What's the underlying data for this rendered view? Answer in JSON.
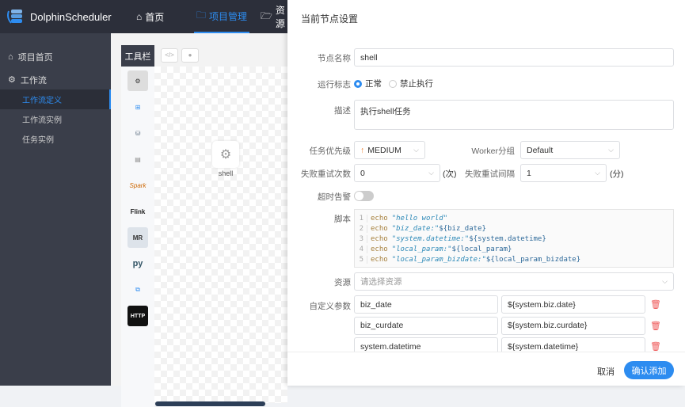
{
  "header": {
    "app_name": "DolphinScheduler",
    "nav": [
      {
        "label": "首页",
        "icon": "home-icon"
      },
      {
        "label": "项目管理",
        "icon": "folder-settings-icon",
        "active": true
      },
      {
        "label": "资源",
        "icon": "folder-icon"
      }
    ]
  },
  "sidebar": {
    "items": [
      {
        "label": "项目首页",
        "icon": "home-icon"
      },
      {
        "label": "工作流",
        "icon": "gear-icon"
      }
    ],
    "sub_items": [
      {
        "label": "工作流定义",
        "active": true
      },
      {
        "label": "工作流实例"
      },
      {
        "label": "任务实例"
      }
    ]
  },
  "canvas": {
    "toolbar_label": "工具栏",
    "tool_buttons": [
      "</>",
      "●"
    ],
    "tools": [
      "shell",
      "sub_process",
      "procedure",
      "sql",
      "spark",
      "flink",
      "mr",
      "python",
      "dependent",
      "http"
    ],
    "tool_text": {
      "spark": "Spark",
      "flink": "Flink",
      "mr": "MR",
      "python": "py",
      "http": "HTTP"
    },
    "node_label": "shell"
  },
  "drawer": {
    "title": "当前节点设置",
    "node_name_label": "节点名称",
    "node_name": "shell",
    "run_flag_label": "运行标志",
    "run_flag_options": [
      "正常",
      "禁止执行"
    ],
    "run_flag_selected": "正常",
    "desc_label": "描述",
    "desc": "执行shell任务",
    "priority_label": "任务优先级",
    "priority": "MEDIUM",
    "priority_color": "#f0802d",
    "worker_group_label": "Worker分组",
    "worker_group": "Default",
    "retry_times_label": "失败重试次数",
    "retry_times": "0",
    "retry_times_unit": "(次)",
    "retry_interval_label": "失败重试间隔",
    "retry_interval": "1",
    "retry_interval_unit": "(分)",
    "timeout_label": "超时告警",
    "timeout_enabled": false,
    "script_label": "脚本",
    "script_lines": [
      {
        "n": "1",
        "kw": "echo",
        "str": "\"hello world\"",
        "var": ""
      },
      {
        "n": "2",
        "kw": "echo",
        "str": "\"biz_date:\"",
        "var": "${biz_date}"
      },
      {
        "n": "3",
        "kw": "echo",
        "str": "\"system.datetime:\"",
        "var": "${system.datetime}"
      },
      {
        "n": "4",
        "kw": "echo",
        "str": "\"local_param:\"",
        "var": "${local_param}"
      },
      {
        "n": "5",
        "kw": "echo",
        "str": "\"local_param_bizdate:\"",
        "var": "${local_param_bizdate}"
      }
    ],
    "resource_label": "资源",
    "resource_placeholder": "请选择资源",
    "custom_params_label": "自定义参数",
    "custom_params": [
      {
        "key": "biz_date",
        "value": "${system.biz.date}"
      },
      {
        "key": "biz_curdate",
        "value": "${system.biz.curdate}"
      },
      {
        "key": "system.datetime",
        "value": "${system.datetime}"
      }
    ],
    "cancel_label": "取消",
    "confirm_label": "确认添加"
  }
}
